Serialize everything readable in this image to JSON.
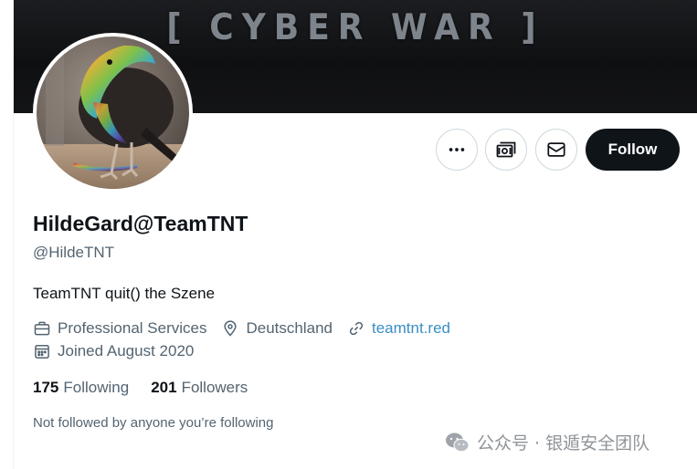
{
  "banner": {
    "text": "[ CYBER WAR ]"
  },
  "profile": {
    "display_name": "HildeGard@TeamTNT",
    "handle": "@HildeTNT",
    "bio": "TeamTNT quit() the Szene",
    "category": "Professional Services",
    "location": "Deutschland",
    "website": "teamtnt.red",
    "joined": "Joined August 2020",
    "following_count": "175",
    "following_label": "Following",
    "followers_count": "201",
    "followers_label": "Followers",
    "not_followed_text": "Not followed by anyone you’re following"
  },
  "actions": {
    "more_icon": "more-horizontal-icon",
    "subscribe_icon": "money-icon",
    "message_icon": "envelope-icon",
    "follow_label": "Follow"
  },
  "watermark": {
    "text": "公众号 · 银遁安全团队"
  },
  "colors": {
    "text_primary": "#0f1419",
    "text_secondary": "#536471",
    "link": "#3a8fc4",
    "follow_button": "#0f1419",
    "border": "#cfd9de",
    "banner": "#131416"
  }
}
